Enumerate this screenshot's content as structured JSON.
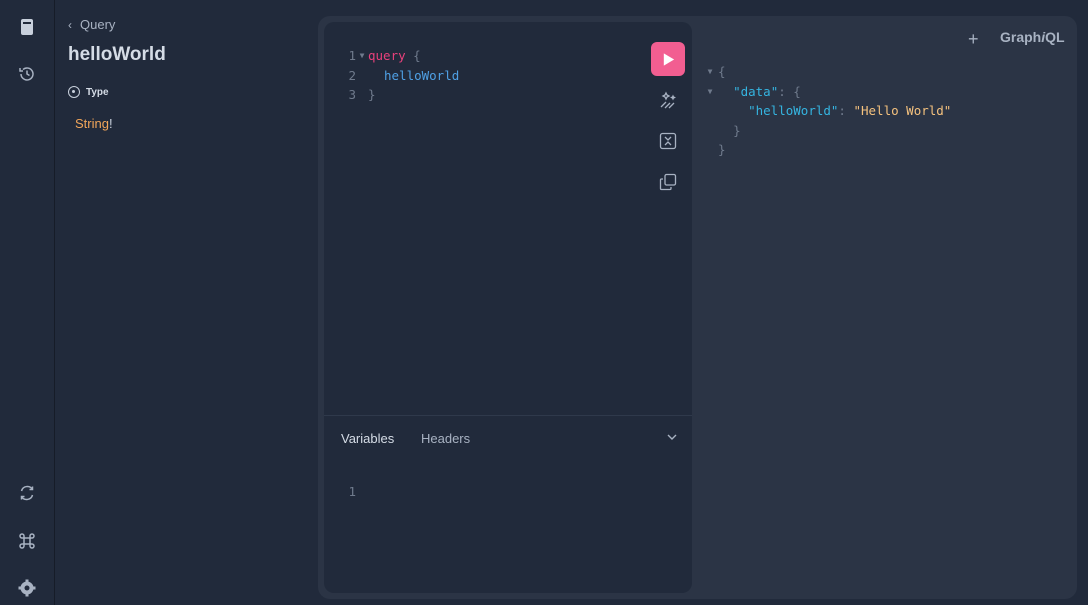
{
  "sidebar": {
    "icons": [
      "docs-icon",
      "history-icon",
      "refetch-schema-icon",
      "shortcuts-icon",
      "settings-icon"
    ]
  },
  "docs": {
    "breadcrumb": "Query",
    "title": "helloWorld",
    "type_section_label": "Type",
    "type_name": "String",
    "type_suffix": "!"
  },
  "editor": {
    "lines": [
      {
        "num": "1",
        "keyword": "query",
        "brace": "{"
      },
      {
        "num": "2",
        "field": "helloWorld"
      },
      {
        "num": "3",
        "brace": "}"
      }
    ]
  },
  "variables": {
    "tab_variables": "Variables",
    "tab_headers": "Headers",
    "line_num": "1"
  },
  "header": {
    "add_tab": "+",
    "brand_a": "Graph",
    "brand_b": "i",
    "brand_c": "QL"
  },
  "response": {
    "open": "{",
    "data_key": "\"data\"",
    "colon": ": ",
    "data_open": "{",
    "field_key": "\"helloWorld\"",
    "field_value": "\"Hello World\"",
    "inner_close": "}",
    "outer_close": "}"
  },
  "colors": {
    "accent": "#f25e91",
    "background": "#212a3b",
    "panel": "#2b3445"
  }
}
